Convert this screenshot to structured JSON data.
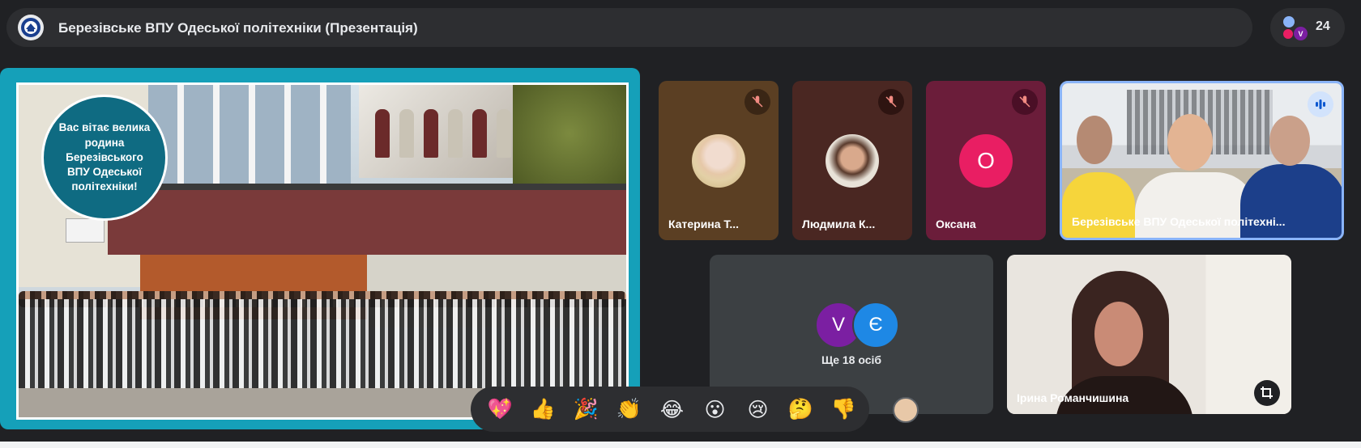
{
  "meeting": {
    "title": "Березівське ВПУ Одеської політехніки (Презентація)",
    "participant_count": "24"
  },
  "presentation": {
    "greeting": "Вас вітає велика родина Березівського ВПУ Одеської політехніки!"
  },
  "tiles": [
    {
      "name": "Катерина Т...",
      "muted": true
    },
    {
      "name": "Людмила К...",
      "muted": true
    },
    {
      "name": "Оксана",
      "muted": true,
      "initial": "О"
    },
    {
      "name": "Березівське ВПУ Одеської політехні...",
      "speaking": true
    }
  ],
  "more": {
    "initials": [
      "V",
      "Є"
    ],
    "label": "Ще 18 осіб"
  },
  "speaker": {
    "name": "Ірина Романчишина"
  },
  "people_initials": [
    "V"
  ],
  "reactions": [
    "💖",
    "👍",
    "🎉",
    "👏",
    "😂",
    "😮",
    "😢",
    "🤔",
    "👎"
  ],
  "colors": {
    "background": "#202124",
    "presentation_frame": "#15a0b9",
    "tile_katerina": "#5b3f23",
    "tile_ludmyla": "#4a2722",
    "tile_oksana": "#6b1d3a",
    "avatar_oksana": "#e91e63",
    "avatar_v": "#7b1fa2",
    "avatar_ye": "#1e88e5"
  }
}
